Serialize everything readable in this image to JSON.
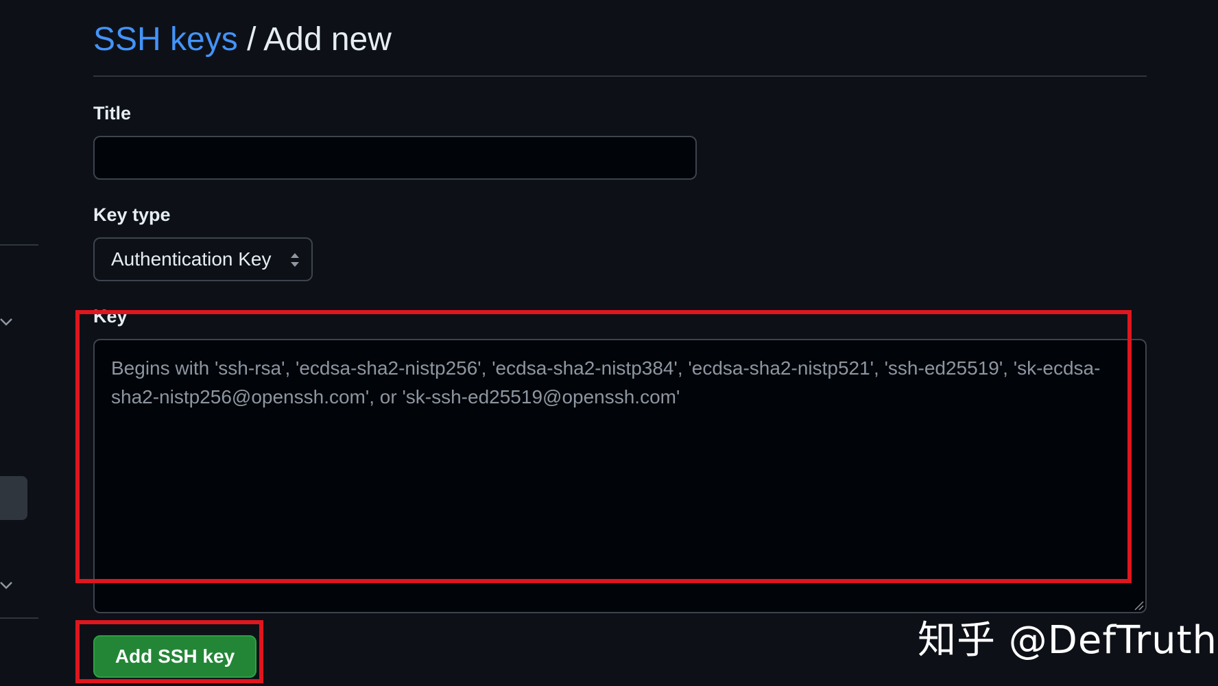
{
  "breadcrumb": {
    "parent": "SSH keys",
    "separator": "/",
    "current": "Add new"
  },
  "form": {
    "title_label": "Title",
    "title_value": "",
    "key_type_label": "Key type",
    "key_type_value": "Authentication Key",
    "key_label": "Key",
    "key_placeholder": "Begins with 'ssh-rsa', 'ecdsa-sha2-nistp256', 'ecdsa-sha2-nistp384', 'ecdsa-sha2-nistp521', 'ssh-ed25519', 'sk-ecdsa-sha2-nistp256@openssh.com', or 'sk-ssh-ed25519@openssh.com'",
    "submit_label": "Add SSH key"
  },
  "watermark": "知乎 @DefTruth",
  "colors": {
    "background": "#0d1117",
    "link": "#4493f8",
    "primary_button": "#238636",
    "annotation": "#e0161e"
  },
  "icons": {
    "select_arrows": "select-arrows-icon",
    "sidebar_chevron": "chevron-down-icon",
    "resize": "resize-handle-icon"
  }
}
